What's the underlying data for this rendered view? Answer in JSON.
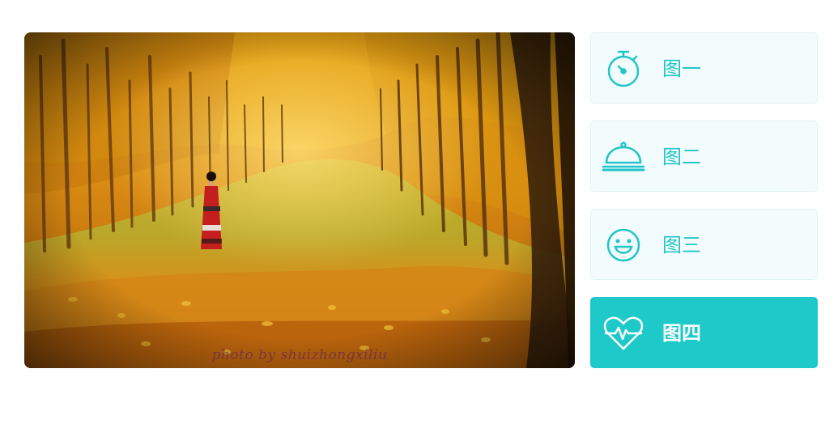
{
  "gallery": {
    "photo": {
      "alt": "Autumn forest path",
      "watermark": "photo by shuizhongxiliu"
    },
    "tabs": [
      {
        "label": "图一",
        "icon": "stopwatch-icon",
        "active": false
      },
      {
        "label": "图二",
        "icon": "cloche-icon",
        "active": false
      },
      {
        "label": "图三",
        "icon": "smiley-icon",
        "active": false
      },
      {
        "label": "图四",
        "icon": "heartbeat-icon",
        "active": true
      }
    ]
  },
  "colors": {
    "accent": "#1dc9c9",
    "tab_background": "#f3fcfd",
    "tab_border": "#dff3f4"
  }
}
